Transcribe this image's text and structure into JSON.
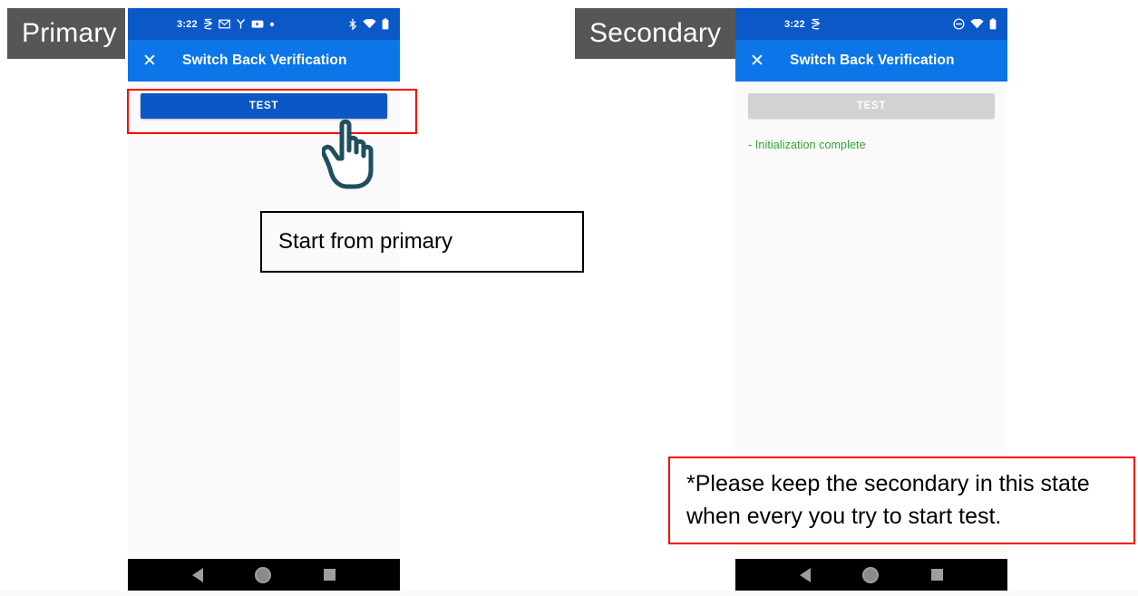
{
  "devices": [
    {
      "label": "Primary",
      "status_bar": {
        "time": "3:22",
        "left_icons": [
          "sim-icon",
          "mail-icon",
          "fit-icon",
          "youtube-icon",
          "dot-icon"
        ],
        "right_icons": [
          "bluetooth-icon",
          "wifi-icon",
          "battery-icon"
        ]
      },
      "app_bar": {
        "close_label": "✕",
        "title": "Switch Back Verification"
      },
      "test_button": {
        "label": "TEST",
        "state": "enabled"
      },
      "log_lines": []
    },
    {
      "label": "Secondary",
      "status_bar": {
        "time": "3:22",
        "left_icons": [
          "sim-icon"
        ],
        "right_icons": [
          "do-not-disturb-icon",
          "wifi-icon",
          "battery-icon"
        ]
      },
      "app_bar": {
        "close_label": "✕",
        "title": "Switch Back Verification"
      },
      "test_button": {
        "label": "TEST",
        "state": "disabled"
      },
      "log_lines": [
        "- Initialization complete"
      ]
    }
  ],
  "nav_bar": {
    "back_icon": "triangle-back-icon",
    "home_icon": "circle-home-icon",
    "recents_icon": "square-recents-icon"
  },
  "annotations": {
    "primary_callout": "Start from primary",
    "secondary_callout": "*Please keep the secondary in this state when every you try to start test.",
    "highlight_color": "#ff0000",
    "cursor": "pointing-hand-cursor"
  }
}
